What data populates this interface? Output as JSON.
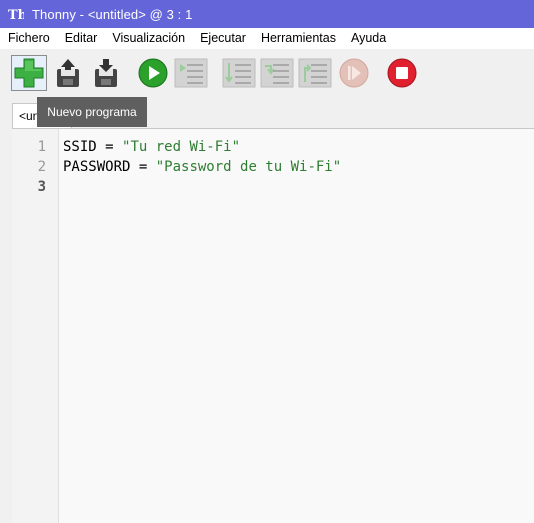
{
  "window": {
    "title": "Thonny  -  <untitled>  @  3 : 1",
    "app_icon": "thonny-icon"
  },
  "menu": {
    "items": [
      "Fichero",
      "Editar",
      "Visualización",
      "Ejecutar",
      "Herramientas",
      "Ayuda"
    ]
  },
  "toolbar": {
    "buttons": [
      {
        "icon": "new-file-icon",
        "color": "#3cb043"
      },
      {
        "icon": "open-file-icon"
      },
      {
        "icon": "save-file-icon"
      },
      {
        "icon": "run-icon",
        "color": "#2ba02b"
      },
      {
        "icon": "debug-icon"
      },
      {
        "icon": "step-over-icon"
      },
      {
        "icon": "step-into-icon"
      },
      {
        "icon": "step-out-icon"
      },
      {
        "icon": "resume-icon"
      },
      {
        "icon": "stop-icon",
        "color": "#e0202e"
      }
    ],
    "tooltip": "Nuevo programa"
  },
  "editor": {
    "tab_label": "<un",
    "lines": [
      {
        "number": "1",
        "var": "SSID",
        "op": " = ",
        "value": "\"Tu red Wi-Fi\""
      },
      {
        "number": "2",
        "var": "PASSWORD",
        "op": " = ",
        "value": "\"Password de tu Wi-Fi\""
      },
      {
        "number": "3",
        "var": "",
        "op": "",
        "value": ""
      }
    ],
    "cursor": {
      "line": 3,
      "column": 1
    }
  }
}
